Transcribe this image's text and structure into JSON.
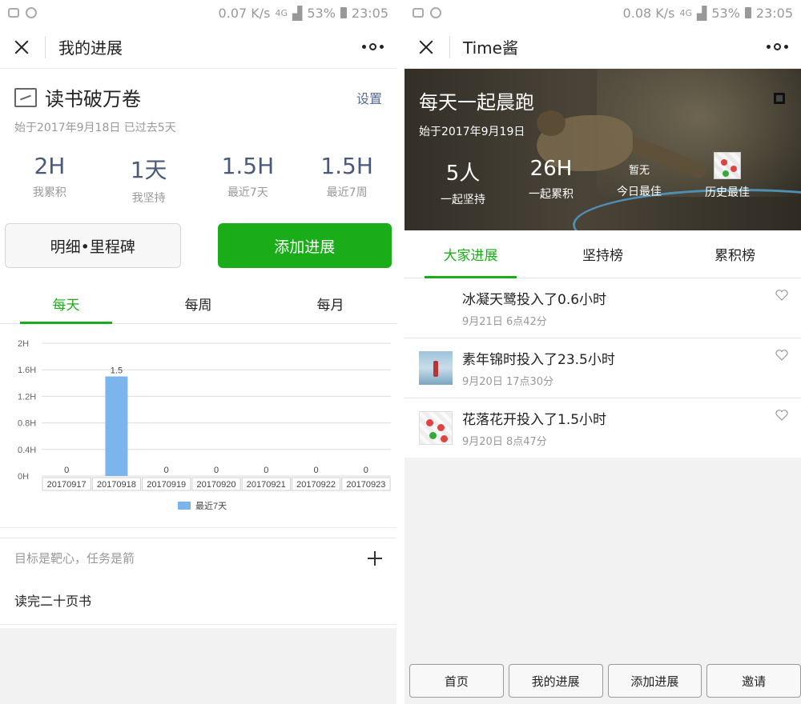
{
  "left": {
    "status": {
      "speed": "0.07 K/s",
      "battery": "53%",
      "time": "23:05",
      "net": "4G"
    },
    "nav": {
      "title": "我的进展"
    },
    "goal": {
      "title": "读书破万卷",
      "settings": "设置",
      "subtitle": "始于2017年9月18日 已过去5天"
    },
    "stats": [
      {
        "value": "2H",
        "label": "我累积"
      },
      {
        "value": "1天",
        "label": "我坚持"
      },
      {
        "value": "1.5H",
        "label": "最近7天"
      },
      {
        "value": "1.5H",
        "label": "最近7周"
      }
    ],
    "buttons": {
      "detail": "明细•里程碑",
      "add": "添加进展"
    },
    "tabs": [
      "每天",
      "每周",
      "每月"
    ],
    "active_tab": 0,
    "target": {
      "hint": "目标是靶心，任务是箭",
      "task": "读完二十页书"
    }
  },
  "chart_data": {
    "type": "bar",
    "categories": [
      "20170917",
      "20170918",
      "20170919",
      "20170920",
      "20170921",
      "20170922",
      "20170923"
    ],
    "values": [
      0,
      1.5,
      0,
      0,
      0,
      0,
      0
    ],
    "value_labels": [
      "0",
      "1.5",
      "0",
      "0",
      "0",
      "0",
      "0"
    ],
    "yticks": [
      "0H",
      "0.4H",
      "0.8H",
      "1.2H",
      "1.6H",
      "2H"
    ],
    "ylim": [
      0,
      2
    ],
    "legend": "最近7天",
    "legend_position": "bottom",
    "bar_color": "#7cb5ec",
    "grid": true
  },
  "right": {
    "status": {
      "speed": "0.08 K/s",
      "battery": "53%",
      "time": "23:05",
      "net": "4G"
    },
    "nav": {
      "title": "Time酱"
    },
    "hero": {
      "title": "每天一起晨跑",
      "subtitle": "始于2017年9月19日",
      "stats": [
        {
          "value": "5人",
          "label": "一起坚持"
        },
        {
          "value": "26H",
          "label": "一起累积"
        },
        {
          "value": "暂无",
          "label": "今日最佳"
        },
        {
          "value": "",
          "label": "历史最佳"
        }
      ]
    },
    "tabs": [
      "大家进展",
      "坚持榜",
      "累积榜"
    ],
    "active_tab": 0,
    "feed": [
      {
        "text": "冰凝天鹭投入了0.6小时",
        "date": "9月21日 6点42分",
        "avatar": "blank"
      },
      {
        "text": "素年锦时投入了23.5小时",
        "date": "9月20日 17点30分",
        "avatar": "sea"
      },
      {
        "text": "花落花开投入了1.5小时",
        "date": "9月20日 8点47分",
        "avatar": "flower"
      }
    ],
    "bottom_bar": [
      "首页",
      "我的进展",
      "添加进展",
      "邀请"
    ]
  }
}
